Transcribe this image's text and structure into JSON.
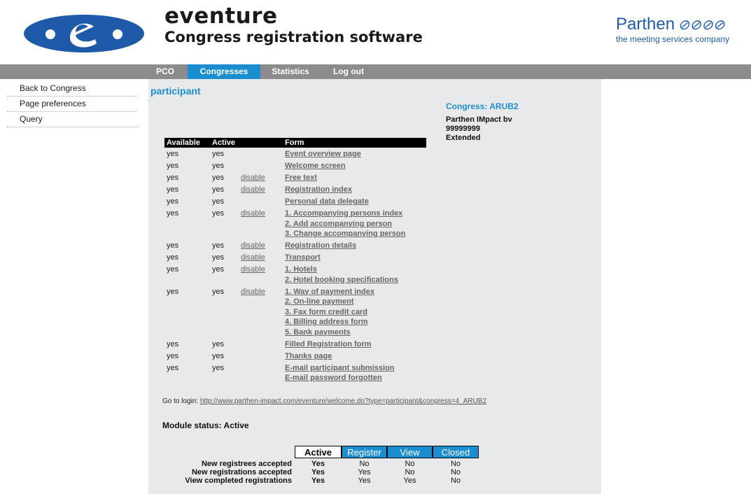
{
  "header": {
    "brand_name": "eventure",
    "brand_subtitle": "Congress registration software",
    "partner_name": "Parthen",
    "partner_tagline": "the meeting services company"
  },
  "nav": {
    "tabs": [
      {
        "label": "PCO"
      },
      {
        "label": "Congresses"
      },
      {
        "label": "Statistics"
      },
      {
        "label": "Log out"
      }
    ]
  },
  "sidebar": {
    "items": [
      {
        "label": "Back to Congress"
      },
      {
        "label": "Page preferences"
      },
      {
        "label": "Query"
      }
    ]
  },
  "main": {
    "title": "participant",
    "congress": {
      "label": "Congress: ARUB2",
      "org": "Parthen IMpact bv",
      "number": "99999999",
      "type": "Extended"
    },
    "form_table": {
      "headers": [
        "Available",
        "Active",
        "Form"
      ],
      "rows": [
        {
          "available": "yes",
          "active": "yes",
          "action": "",
          "forms": [
            "Event overview page"
          ]
        },
        {
          "available": "yes",
          "active": "yes",
          "action": "",
          "forms": [
            "Welcome screen"
          ]
        },
        {
          "available": "yes",
          "active": "yes",
          "action": "disable",
          "forms": [
            "Free text"
          ]
        },
        {
          "available": "yes",
          "active": "yes",
          "action": "disable",
          "forms": [
            "Registration index"
          ]
        },
        {
          "available": "yes",
          "active": "yes",
          "action": "",
          "forms": [
            "Personal data delegate"
          ]
        },
        {
          "available": "yes",
          "active": "yes",
          "action": "disable",
          "forms": [
            "1. Accompanying persons index",
            "2. Add accompanying person",
            "3. Change accompanying person"
          ]
        },
        {
          "available": "yes",
          "active": "yes",
          "action": "disable",
          "forms": [
            "Registration details"
          ]
        },
        {
          "available": "yes",
          "active": "yes",
          "action": "disable",
          "forms": [
            "Transport"
          ]
        },
        {
          "available": "yes",
          "active": "yes",
          "action": "disable",
          "forms": [
            "1. Hotels",
            "2. Hotel booking specifications"
          ]
        },
        {
          "available": "yes",
          "active": "yes",
          "action": "disable",
          "forms": [
            "1. Way of payment index",
            "2. On-line payment",
            "3. Fax form credit card",
            "4. Billing address form",
            "5. Bank payments"
          ]
        },
        {
          "available": "yes",
          "active": "yes",
          "action": "",
          "forms": [
            "Filled Registration form"
          ]
        },
        {
          "available": "yes",
          "active": "yes",
          "action": "",
          "forms": [
            "Thanks page"
          ]
        },
        {
          "available": "yes",
          "active": "yes",
          "action": "",
          "forms": [
            "E-mail participant submission",
            "E-mail password forgotten"
          ]
        }
      ]
    },
    "login": {
      "label": "Go to login:",
      "url": "http://www.parthen-impact.com/eventure/welcome.do?type=participant&congress=4_ARUB2"
    },
    "module_status": "Module status: Active",
    "status_table": {
      "headers": [
        "Active",
        "Register",
        "View",
        "Closed"
      ],
      "rows": [
        {
          "label": "New registrees accepted",
          "values": [
            "Yes",
            "No",
            "No",
            "No"
          ]
        },
        {
          "label": "New registrations accepted",
          "values": [
            "Yes",
            "Yes",
            "No",
            "No"
          ]
        },
        {
          "label": "View completed registrations",
          "values": [
            "Yes",
            "Yes",
            "Yes",
            "No"
          ]
        }
      ]
    }
  },
  "colors": {
    "accent": "#1a8ed1",
    "navbar": "#8c8c8c",
    "content_bg": "#e8e9eb",
    "brand_blue": "#1f5aa8"
  }
}
